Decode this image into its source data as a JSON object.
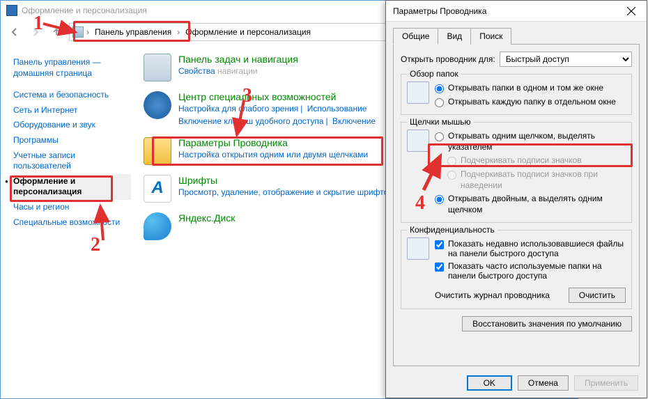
{
  "cp": {
    "title": "Оформление и персонализация",
    "breadcrumb": {
      "seg1": "Панель управления",
      "seg2": "Оформление и персонализация"
    },
    "sidebar": {
      "home": "Панель управления — домашняя страница",
      "items": [
        "Система и безопасность",
        "Сеть и Интернет",
        "Оборудование и звук",
        "Программы",
        "Учетные записи пользователей",
        "Оформление и персонализация",
        "Часы и регион",
        "Специальные возможности"
      ]
    },
    "categories": [
      {
        "title": "Панель задач и навигация",
        "subs": [
          "Свойства навигации"
        ]
      },
      {
        "title": "Центр специальных возможностей",
        "subs": [
          "Настройка для слабого зрения",
          "Использование",
          "Включение клавиш удобного доступа",
          "Включение"
        ]
      },
      {
        "title": "Параметры Проводника",
        "subs": [
          "Настройка открытия одним или двумя щелчками"
        ]
      },
      {
        "title": "Шрифты",
        "subs": [
          "Просмотр, удаление, отображение и скрытие шрифтов"
        ]
      },
      {
        "title": "Яндекс.Диск",
        "subs": []
      }
    ]
  },
  "dlg": {
    "title": "Параметры Проводника",
    "tabs": [
      "Общие",
      "Вид",
      "Поиск"
    ],
    "open_label": "Открыть проводник для:",
    "open_value": "Быстрый доступ",
    "group_browse": {
      "title": "Обзор папок",
      "opt1": "Открывать папки в одном и том же окне",
      "opt2": "Открывать каждую папку в отдельном окне"
    },
    "group_click": {
      "title": "Щелчки мышью",
      "opt1": "Открывать одним щелчком, выделять указателем",
      "opt1a": "Подчеркивать подписи значков",
      "opt1b": "Подчеркивать подписи значков при наведении",
      "opt2": "Открывать двойным, а выделять одним щелчком"
    },
    "group_privacy": {
      "title": "Конфиденциальность",
      "opt1": "Показать недавно использовавшиеся файлы на панели быстрого доступа",
      "opt2": "Показать часто используемые папки на панели быстрого доступа",
      "clear_label": "Очистить журнал проводника",
      "clear_btn": "Очистить"
    },
    "restore_btn": "Восстановить значения по умолчанию",
    "btn_ok": "OK",
    "btn_cancel": "Отмена",
    "btn_apply": "Применить"
  },
  "anno": {
    "n1": "1",
    "n2": "2",
    "n3": "3",
    "n4": "4"
  }
}
